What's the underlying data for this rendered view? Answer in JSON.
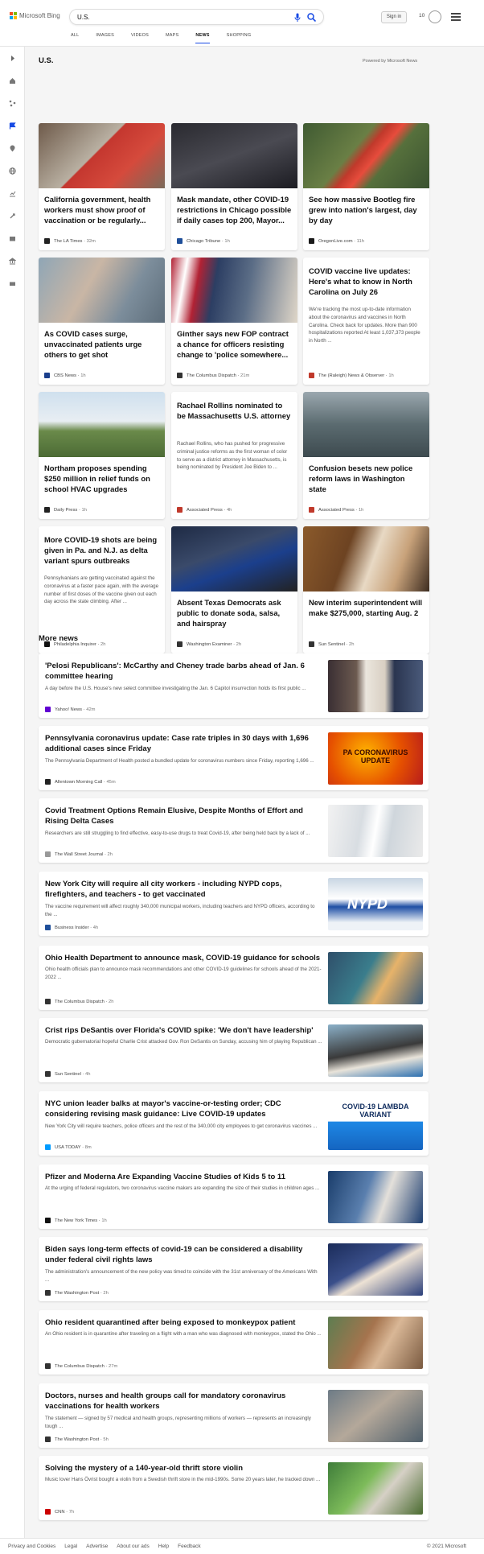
{
  "header": {
    "brand": "Microsoft Bing",
    "query": "U.S.",
    "sign_in": "Sign in",
    "rewards_count": "10",
    "tabs": [
      "ALL",
      "IMAGES",
      "VIDEOS",
      "MAPS",
      "NEWS",
      "SHOPPING"
    ],
    "active_tab": "NEWS"
  },
  "section": {
    "title": "U.S.",
    "powered": "Powered by Microsoft News"
  },
  "cards": [
    {
      "title": "California government, health workers must show proof of vaccination or be regularly...",
      "source": "The LA Times",
      "time": "32m"
    },
    {
      "title": "Mask mandate, other COVID-19 restrictions in Chicago possible if daily cases top 200, Mayor...",
      "source": "Chicago Tribune",
      "time": "1h"
    },
    {
      "title": "See how massive Bootleg fire grew into nation's largest, day by day",
      "source": "OregonLive.com",
      "time": "11h"
    },
    {
      "title": "As COVID cases surge, unvaccinated patients urge others to get shot",
      "source": "CBS News",
      "time": "1h"
    },
    {
      "title": "Ginther says new FOP contract a chance for officers resisting change to 'police somewhere...",
      "source": "The Columbus Dispatch",
      "time": "21m"
    },
    {
      "title": "COVID vaccine live updates: Here's what to know in North Carolina on July 26",
      "desc": "We're tracking the most up-to-date information about the coronavirus and vaccines in North Carolina. Check back for updates. More than 900 hospitalizations reported At least 1,037,373 people in North ...",
      "source": "The (Raleigh) News & Observer",
      "time": "1h"
    },
    {
      "title": "Northam proposes spending $250 million in relief funds on school HVAC upgrades",
      "source": "Daily Press",
      "time": "1h"
    },
    {
      "title": "Rachael Rollins nominated to be Massachusetts U.S. attorney",
      "desc": "Rachael Rollins, who has pushed for progressive criminal justice reforms as the first woman of color to serve as a district attorney in Massachusetts, is being nominated by President Joe Biden to ...",
      "source": "Associated Press",
      "time": "4h"
    },
    {
      "title": "Confusion besets new police reform laws in Washington state",
      "source": "Associated Press",
      "time": "1h"
    },
    {
      "title": "More COVID-19 shots are being given in Pa. and N.J. as delta variant spurs outbreaks",
      "desc": "Pennsylvanians are getting vaccinated against the coronavirus at a faster pace again, with the average number of first doses of the vaccine given out each day across the state climbing. After ...",
      "source": "Philadelphia Inquirer",
      "time": "2h"
    },
    {
      "title": "Absent Texas Democrats ask public to donate soda, salsa, and hairspray",
      "source": "Washington Examiner",
      "time": "2h"
    },
    {
      "title": "New interim superintendent will make $275,000, starting Aug. 2",
      "source": "Sun Sentinel",
      "time": "2h"
    }
  ],
  "more_news": {
    "title": "More news",
    "items": [
      {
        "title": "'Pelosi Republicans': McCarthy and Cheney trade barbs ahead of Jan. 6 committee hearing",
        "desc": "A day before the U.S. House's new select committee investigating the Jan. 6 Capitol insurrection holds its first public ...",
        "source": "Yahoo! News",
        "time": "42m"
      },
      {
        "title": "Pennsylvania coronavirus update: Case rate triples in 30 days with 1,696 additional cases since Friday",
        "desc": "The Pennsylvania Department of Health posted a bundled update for coronavirus numbers since Friday, reporting 1,696 ...",
        "source": "Allentown Morning Call",
        "time": "45m",
        "thumb_text": "PA CORONAVIRUS UPDATE"
      },
      {
        "title": "Covid Treatment Options Remain Elusive, Despite Months of Effort and Rising Delta Cases",
        "desc": "Researchers are still struggling to find effective, easy-to-use drugs to treat Covid-19, after being held back by a lack of ...",
        "source": "The Wall Street Journal",
        "time": "2h"
      },
      {
        "title": "New York City will require all city workers - including NYPD cops, firefighters, and teachers - to get vaccinated",
        "desc": "The vaccine requirement will affect roughly 340,000 municipal workers, including teachers and NYPD officers, according to the ...",
        "source": "Business Insider",
        "time": "4h",
        "thumb_text": "NYPD"
      },
      {
        "title": "Ohio Health Department to announce mask, COVID-19 guidance for schools",
        "desc": "Ohio health officials plan to announce mask recommendations and other COVID-19 guidelines for schools ahead of the 2021-2022 ...",
        "source": "The Columbus Dispatch",
        "time": "2h"
      },
      {
        "title": "Crist rips DeSantis over Florida's COVID spike: 'We don't have leadership'",
        "desc": "Democratic gubernatorial hopeful Charlie Crist attacked Gov. Ron DeSantis on Sunday, accusing him of playing Republican ...",
        "source": "Sun Sentinel",
        "time": "4h"
      },
      {
        "title": "NYC union leader balks at mayor's vaccine-or-testing order; CDC considering revising mask guidance: Live COVID-19 updates",
        "desc": "New York City will require teachers, police officers and the rest of the 340,000 city employees to get coronavirus vaccines ...",
        "source": "USA TODAY",
        "time": "8m",
        "thumb_text": "COVID-19 LAMBDA VARIANT"
      },
      {
        "title": "Pfizer and Moderna Are Expanding Vaccine Studies of Kids 5 to 11",
        "desc": "At the urging of federal regulators, two coronavirus vaccine makers are expanding the size of their studies in children ages ...",
        "source": "The New York Times",
        "time": "1h"
      },
      {
        "title": "Biden says long-term effects of covid-19 can be considered a disability under federal civil rights laws",
        "desc": "The administration's announcement of the new policy was timed to coincide with the 31st anniversary of the Americans With ...",
        "source": "The Washington Post",
        "time": "2h"
      },
      {
        "title": "Ohio resident quarantined after being exposed to monkeypox patient",
        "desc": "An Ohio resident is in quarantine after traveling on a flight with a man who was diagnosed with monkeypox, stated the Ohio ...",
        "source": "The Columbus Dispatch",
        "time": "27m"
      },
      {
        "title": "Doctors, nurses and health groups call for mandatory coronavirus vaccinations for health workers",
        "desc": "The statement — signed by 57 medical and health groups, representing millions of workers — represents an increasingly tough ...",
        "source": "The Washington Post",
        "time": "5h"
      },
      {
        "title": "Solving the mystery of a 140-year-old thrift store violin",
        "desc": "Music lover Hans Övrist bought a violin from a Swedish thrift store in the mid-1990s. Some 20 years later, he tracked down ...",
        "source": "CNN",
        "time": "7h"
      }
    ]
  },
  "footer": {
    "links": [
      "Privacy and Cookies",
      "Legal",
      "Advertise",
      "About our ads",
      "Help",
      "Feedback"
    ],
    "copyright": "© 2021 Microsoft"
  },
  "colors": {
    "accent": "#174ae4",
    "bing_teal": "#008373",
    "page_bg": "#f5f5f5"
  }
}
